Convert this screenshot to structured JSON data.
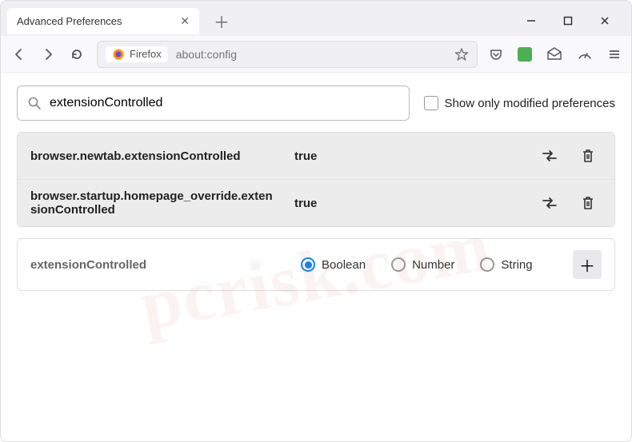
{
  "window": {
    "tab_title": "Advanced Preferences"
  },
  "urlbar": {
    "product": "Firefox",
    "address": "about:config"
  },
  "config": {
    "search_value": "extensionControlled",
    "show_modified_label": "Show only modified preferences",
    "show_modified_checked": false,
    "results": [
      {
        "name": "browser.newtab.extensionControlled",
        "value": "true"
      },
      {
        "name": "browser.startup.homepage_override.extensionControlled",
        "value": "true"
      }
    ],
    "new_pref": {
      "name": "extensionControlled",
      "types": [
        "Boolean",
        "Number",
        "String"
      ],
      "selected_type": "Boolean"
    }
  },
  "watermark": "pcrisk.com"
}
